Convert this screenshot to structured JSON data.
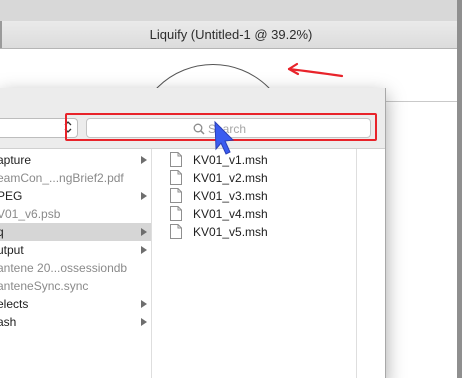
{
  "window": {
    "title": "Liquify (Untitled-1 @ 39.2%)"
  },
  "dialog": {
    "search": {
      "placeholder": "Search",
      "icon": "magnifier-icon"
    },
    "location_chevron": "⌃⌄",
    "sidebar_items": [
      {
        "label": "apture",
        "has_children": true,
        "dim": false,
        "selected": false
      },
      {
        "label": "eamCon_...ngBrief2.pdf",
        "has_children": false,
        "dim": true,
        "selected": false
      },
      {
        "label": "PEG",
        "has_children": true,
        "dim": false,
        "selected": false
      },
      {
        "label": "V01_v6.psb",
        "has_children": false,
        "dim": true,
        "selected": false
      },
      {
        "label": "q",
        "has_children": true,
        "dim": false,
        "selected": true
      },
      {
        "label": "utput",
        "has_children": true,
        "dim": false,
        "selected": false
      },
      {
        "label": "antene 20...ossessiondb",
        "has_children": false,
        "dim": true,
        "selected": false
      },
      {
        "label": "anteneSync.sync",
        "has_children": false,
        "dim": true,
        "selected": false
      },
      {
        "label": "elects",
        "has_children": true,
        "dim": false,
        "selected": false
      },
      {
        "label": "ash",
        "has_children": true,
        "dim": false,
        "selected": false
      }
    ],
    "files": [
      {
        "name": "KV01_v1.msh",
        "icon": "document-icon"
      },
      {
        "name": "KV01_v2.msh",
        "icon": "document-icon"
      },
      {
        "name": "KV01_v3.msh",
        "icon": "document-icon"
      },
      {
        "name": "KV01_v4.msh",
        "icon": "document-icon"
      },
      {
        "name": "KV01_v5.msh",
        "icon": "document-icon"
      }
    ]
  },
  "annotations": {
    "highlight_color": "#e8232a",
    "pointer_color": "#3a5cf0"
  }
}
